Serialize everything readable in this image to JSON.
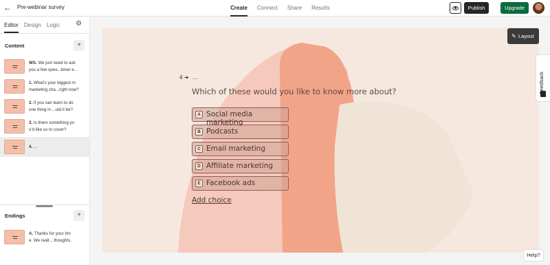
{
  "topbar": {
    "back_icon": "arrow-left-icon",
    "form_title": "Pre-webinar survey",
    "tabs": [
      {
        "label": "Create",
        "active": true
      },
      {
        "label": "Connect",
        "active": false
      },
      {
        "label": "Share",
        "active": false
      },
      {
        "label": "Results",
        "active": false
      }
    ],
    "preview_icon": "eye-icon",
    "publish_label": "Publish",
    "upgrade_label": "Upgrade",
    "upgrade_color": "#0b6b3f"
  },
  "sidebar": {
    "tabs": [
      {
        "label": "Editor",
        "active": true
      },
      {
        "label": "Design",
        "active": false
      },
      {
        "label": "Logic",
        "active": false
      }
    ],
    "settings_icon": "gear-icon",
    "content_label": "Content",
    "add_label": "+",
    "questions": [
      {
        "num": "WS.",
        "line1": " We just need to ask",
        "line2": "you a few ques...binar e..."
      },
      {
        "num": "1.",
        "line1": " What's your biggest m",
        "line2": "marketing cha...right now?"
      },
      {
        "num": "2.",
        "line1": " If you can learn to do",
        "line2": "one thing in ...uld it be?"
      },
      {
        "num": "3.",
        "line1": " Is there something yo",
        "line2": "u'd like us to cover?"
      },
      {
        "num": "4.",
        "line1": " ...",
        "line2": ""
      }
    ],
    "endings_label": "Endings",
    "endings": [
      {
        "num": "A.",
        "line1": " Thanks for your tim",
        "line2": "e. We reall... thoughts."
      }
    ]
  },
  "canvas": {
    "layout_label": "Layout",
    "layout_icon": "pen-icon",
    "question_number": "4",
    "question_arrow": "➜",
    "question_title_placeholder": "...",
    "question_text": "Which of these would you like to know more about?",
    "choices": [
      {
        "key": "A",
        "label": "Social media marketing"
      },
      {
        "key": "B",
        "label": "Podcasts"
      },
      {
        "key": "C",
        "label": "Email marketing"
      },
      {
        "key": "D",
        "label": "Affiliate marketing"
      },
      {
        "key": "E",
        "label": "Facebook ads"
      }
    ],
    "add_choice_label": "Add choice",
    "colors": {
      "background": "#f6e8df",
      "shape_primary": "#f2a488",
      "shape_light": "#f5c9bb",
      "shape_cream": "#efe4d6"
    }
  },
  "feedback": {
    "label": "Feedback"
  },
  "help": {
    "label": "Help?"
  }
}
